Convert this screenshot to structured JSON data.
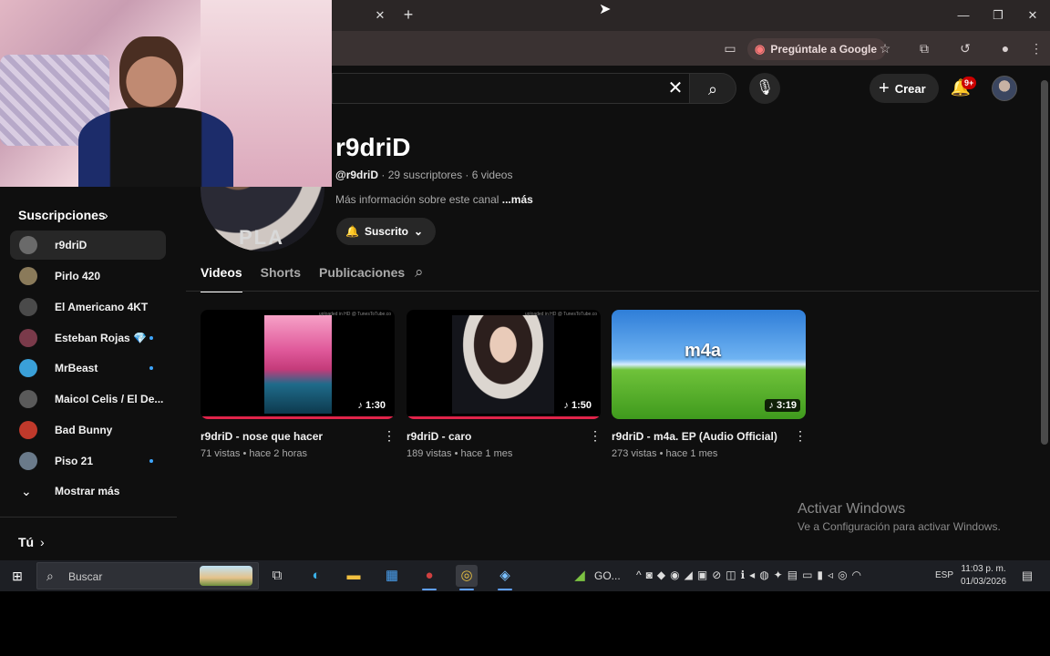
{
  "browser": {
    "tab_close": "✕",
    "new_tab": "+",
    "window_controls": [
      "—",
      "❐",
      "✕"
    ],
    "ask_google_label": "Pregúntale a Google"
  },
  "yt": {
    "create_label": "Crear",
    "notifications_badge": "9+",
    "channel": {
      "name": "r9driD",
      "handle": "@r9driD",
      "meta": " · 29 suscriptores · 6 videos",
      "more_info": "Más información sobre este canal ",
      "more_link": "...más",
      "subscribed_label": "Suscrito",
      "avatar_text": "PLA"
    },
    "tabs": [
      {
        "label": "Videos"
      },
      {
        "label": "Shorts"
      },
      {
        "label": "Publicaciones"
      }
    ],
    "videos": [
      {
        "title": "r9driD - nose que hacer",
        "meta": "71 vistas • hace 2 horas",
        "duration": "♪ 1:30",
        "watermark": "uploaded in HD @ TunesToTube.co"
      },
      {
        "title": "r9driD - caro",
        "meta": "189 vistas • hace 1 mes",
        "duration": "♪ 1:50",
        "watermark": "uploaded in HD @ TunesToTube.co"
      },
      {
        "title": "r9driD - m4a. EP (Audio Official)",
        "meta": "273 vistas • hace 1 mes",
        "duration": "♪ 3:19",
        "thumb_label": "m4a"
      }
    ],
    "sidebar": {
      "subscriptions_label": "Suscripciones",
      "items": [
        {
          "label": "r9driD"
        },
        {
          "label": "Pirlo 420"
        },
        {
          "label": "El Americano 4KT"
        },
        {
          "label": "Esteban Rojas 💎"
        },
        {
          "label": "MrBeast"
        },
        {
          "label": "Maicol Celis / El De..."
        },
        {
          "label": "Bad Bunny"
        },
        {
          "label": "Piso 21"
        }
      ],
      "show_more_label": "Mostrar más",
      "you_label": "Tú"
    },
    "windows_watermark": {
      "title": "Activar Windows",
      "subtitle": "Ve a Configuración para activar Windows."
    }
  },
  "taskbar": {
    "search_label": "Buscar",
    "go_label": "GO...",
    "lang": "ESP",
    "time": "11:03 p. m.",
    "date": "01/03/2026"
  },
  "colors": {
    "yt_bg": "#0f0f0f",
    "progress_red": "#e0244a",
    "chrome_tabbar": "#2b2626",
    "taskbar": "#1d1f24"
  }
}
